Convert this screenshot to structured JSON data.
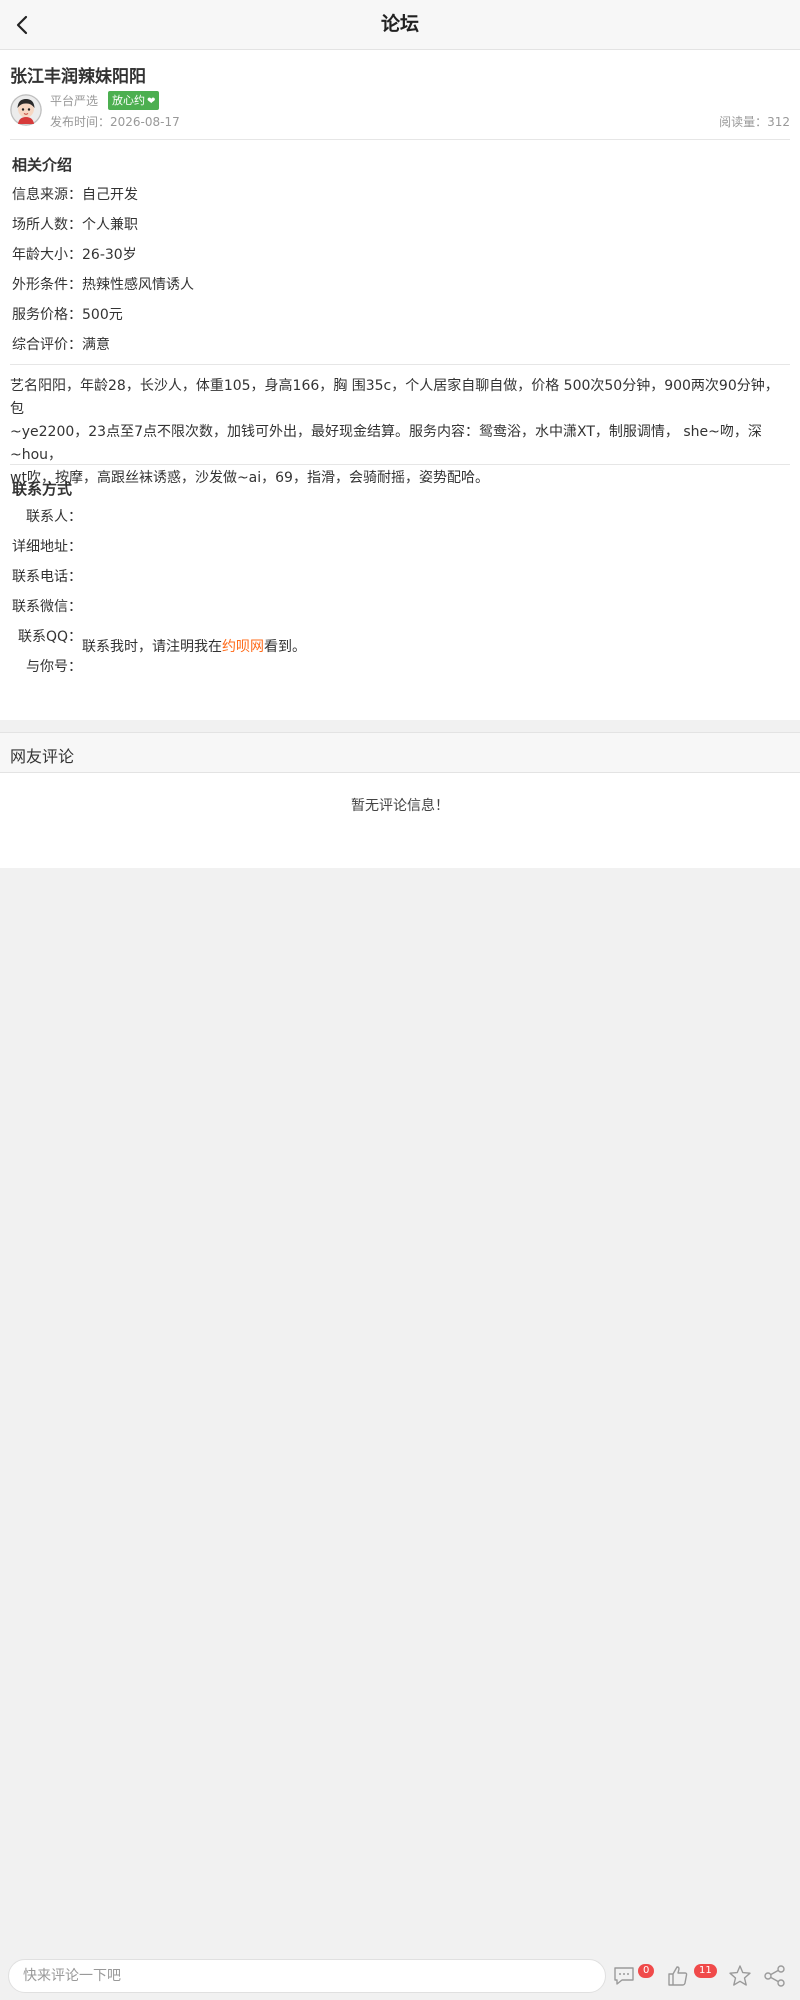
{
  "header": {
    "title": "论坛"
  },
  "post": {
    "title": "张江丰润辣妹阳阳",
    "author": "平台严选",
    "badge": "放心约",
    "publish_label": "发布时间：",
    "publish_date": "2026-08-17",
    "reads_label": "阅读量：",
    "reads": "312"
  },
  "intro": {
    "title": "相关介绍",
    "rows": [
      {
        "label": "信息来源：",
        "value": "自己开发"
      },
      {
        "label": "场所人数：",
        "value": "个人兼职"
      },
      {
        "label": "年龄大小：",
        "value": "26-30岁"
      },
      {
        "label": "外形条件：",
        "value": "热辣性感风情诱人"
      },
      {
        "label": "服务价格：",
        "value": "500元"
      },
      {
        "label": "综合评价：",
        "value": "满意"
      }
    ]
  },
  "description": {
    "line1": "艺名阳阳，年龄28，长沙人，体重105，身高166，胸 围35c，个人居家自聊自做，价格 500次50分钟，900两次90分钟，包",
    "line2": "~ye2200，23点至7点不限次数，加钱可外出，最好现金结算。服务内容：鸳鸯浴，水中潇XT，制服调情， she~吻，深~hou，",
    "line3": "wt吹，按摩，高跟丝袜诱惑，沙发做~ai，69，指滑，会骑耐摇，姿势配哈。"
  },
  "contact": {
    "title": "联系方式",
    "labels": [
      "联系人：",
      "详细地址：",
      "联系电话：",
      "联系微信：",
      "联系QQ：",
      "与你号："
    ],
    "note_prefix": "联系我时，请注明我在",
    "note_site": "约呗网",
    "note_suffix": "看到。"
  },
  "comments": {
    "title": "网友评论",
    "empty": "暂无评论信息！"
  },
  "bottom_bar": {
    "placeholder": "快来评论一下吧",
    "comment_count": "0",
    "like_count": "11"
  },
  "colors": {
    "badge": "#4caf50",
    "site_link": "#ff6b1a",
    "count_badge": "#f04a4a"
  },
  "icons": [
    "back-arrow-icon",
    "avatar",
    "heart-icon",
    "comment-icon",
    "like-icon",
    "star-icon",
    "share-icon"
  ]
}
